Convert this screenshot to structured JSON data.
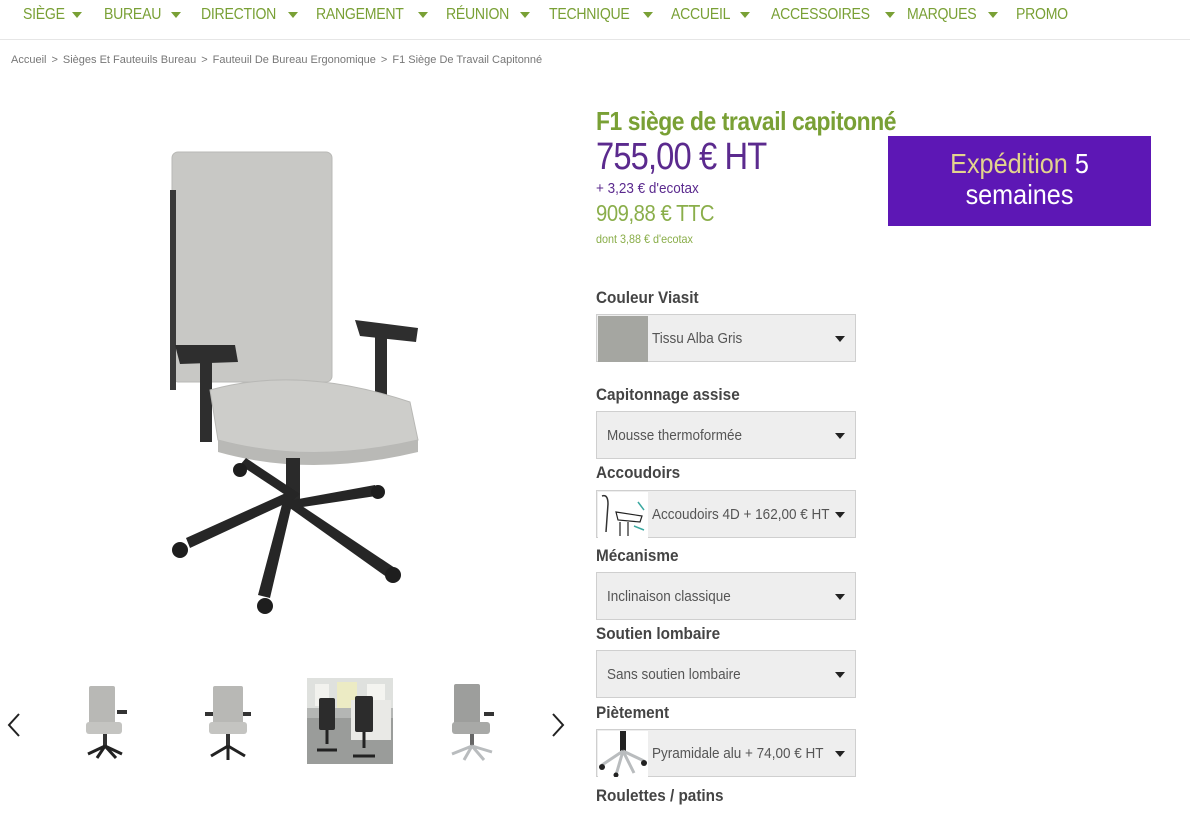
{
  "nav": {
    "items": [
      {
        "label": "SIÈGE",
        "has_caret": true
      },
      {
        "label": "BUREAU",
        "has_caret": true
      },
      {
        "label": "DIRECTION",
        "has_caret": true
      },
      {
        "label": "RANGEMENT",
        "has_caret": true
      },
      {
        "label": "RÉUNION",
        "has_caret": true
      },
      {
        "label": "TECHNIQUE",
        "has_caret": true
      },
      {
        "label": "ACCUEIL",
        "has_caret": true
      },
      {
        "label": "ACCESSOIRES",
        "has_caret": true
      },
      {
        "label": "MARQUES",
        "has_caret": true
      },
      {
        "label": "PROMO",
        "has_caret": false
      }
    ]
  },
  "breadcrumb": {
    "items": [
      "Accueil",
      "Sièges Et Fauteuils Bureau",
      "Fauteuil De Bureau Ergonomique",
      "F1 Siège De Travail Capitonné"
    ],
    "separator": ">"
  },
  "product": {
    "title": "F1 siège de travail capitonné",
    "price_ht": "755,00 € HT",
    "ecotax": "+ 3,23 € d'ecotax",
    "price_ttc": "909,88 € TTC",
    "ecotax_ttc": "dont 3,88 € d'ecotax"
  },
  "shipping": {
    "word": "Expédition",
    "number": "5",
    "unit": "semaines"
  },
  "options": {
    "couleur": {
      "label": "Couleur Viasit",
      "value": "Tissu Alba Gris",
      "swatch_color": "#a5a6a1"
    },
    "capitonnage": {
      "label": "Capitonnage assise",
      "value": "Mousse thermoformée"
    },
    "accoudoirs": {
      "label": "Accoudoirs",
      "value": "Accoudoirs 4D + 162,00 € HT"
    },
    "mecanisme": {
      "label": "Mécanisme",
      "value": "Inclinaison classique"
    },
    "soutien": {
      "label": "Soutien lombaire",
      "value": "Sans soutien lombaire"
    },
    "pietement": {
      "label": "Piètement",
      "value": "Pyramidale alu + 74,00 € HT"
    },
    "roulettes": {
      "label": "Roulettes / patins"
    }
  },
  "gallery": {
    "thumbnails": [
      "chair-front-thumbnail",
      "chair-side-thumbnail",
      "chair-office-scene-thumbnail",
      "chair-alu-base-thumbnail"
    ]
  },
  "colors": {
    "brand_green": "#79a035",
    "price_purple": "#5b2a8e",
    "badge_purple": "#5d17b5",
    "badge_accent": "#e3d48d",
    "chair_fabric": "#c8c8c5"
  }
}
